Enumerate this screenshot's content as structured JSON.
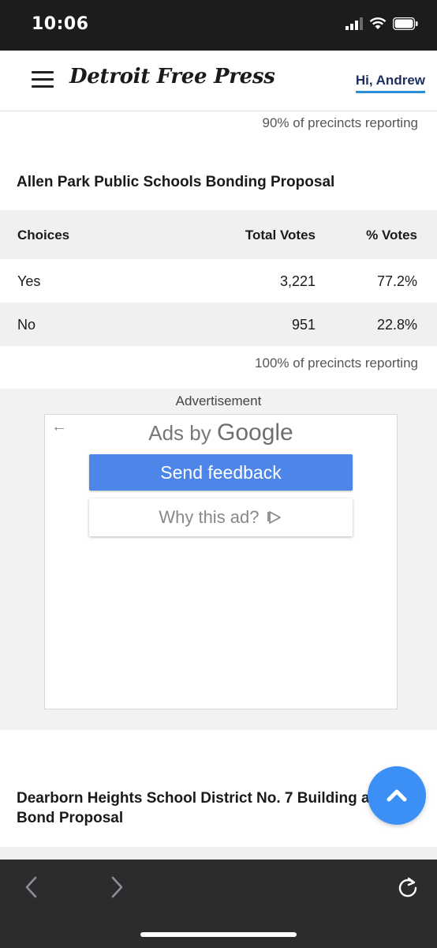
{
  "status_bar": {
    "time": "10:06"
  },
  "header": {
    "brand": "Detroit Free Press",
    "greeting": "Hi, Andrew"
  },
  "previous_race": {
    "reporting": "90% of precincts reporting"
  },
  "race": {
    "title": "Allen Park Public Schools Bonding Proposal",
    "columns": [
      "Choices",
      "Total Votes",
      "% Votes"
    ],
    "rows": [
      {
        "choice": "Yes",
        "votes": "3,221",
        "percent": "77.2%"
      },
      {
        "choice": "No",
        "votes": "951",
        "percent": "22.8%"
      }
    ],
    "reporting": "100% of precincts reporting"
  },
  "ad": {
    "label": "Advertisement",
    "ads_by_prefix": "Ads by",
    "ads_by_brand": "Google",
    "send_feedback": "Send feedback",
    "why_this_ad": "Why this ad?"
  },
  "next_race": {
    "title": "Dearborn Heights School District No. 7 Building and Site Bond Proposal"
  },
  "icons": {
    "menu": "hamburger-menu-icon",
    "scroll_top": "chevron-up-icon",
    "back": "chevron-left-icon",
    "forward": "chevron-right-icon",
    "reload": "reload-icon"
  },
  "colors": {
    "accent": "#2a8fd8",
    "fab": "#3b8ff5",
    "ad_button": "#4d86e8"
  }
}
